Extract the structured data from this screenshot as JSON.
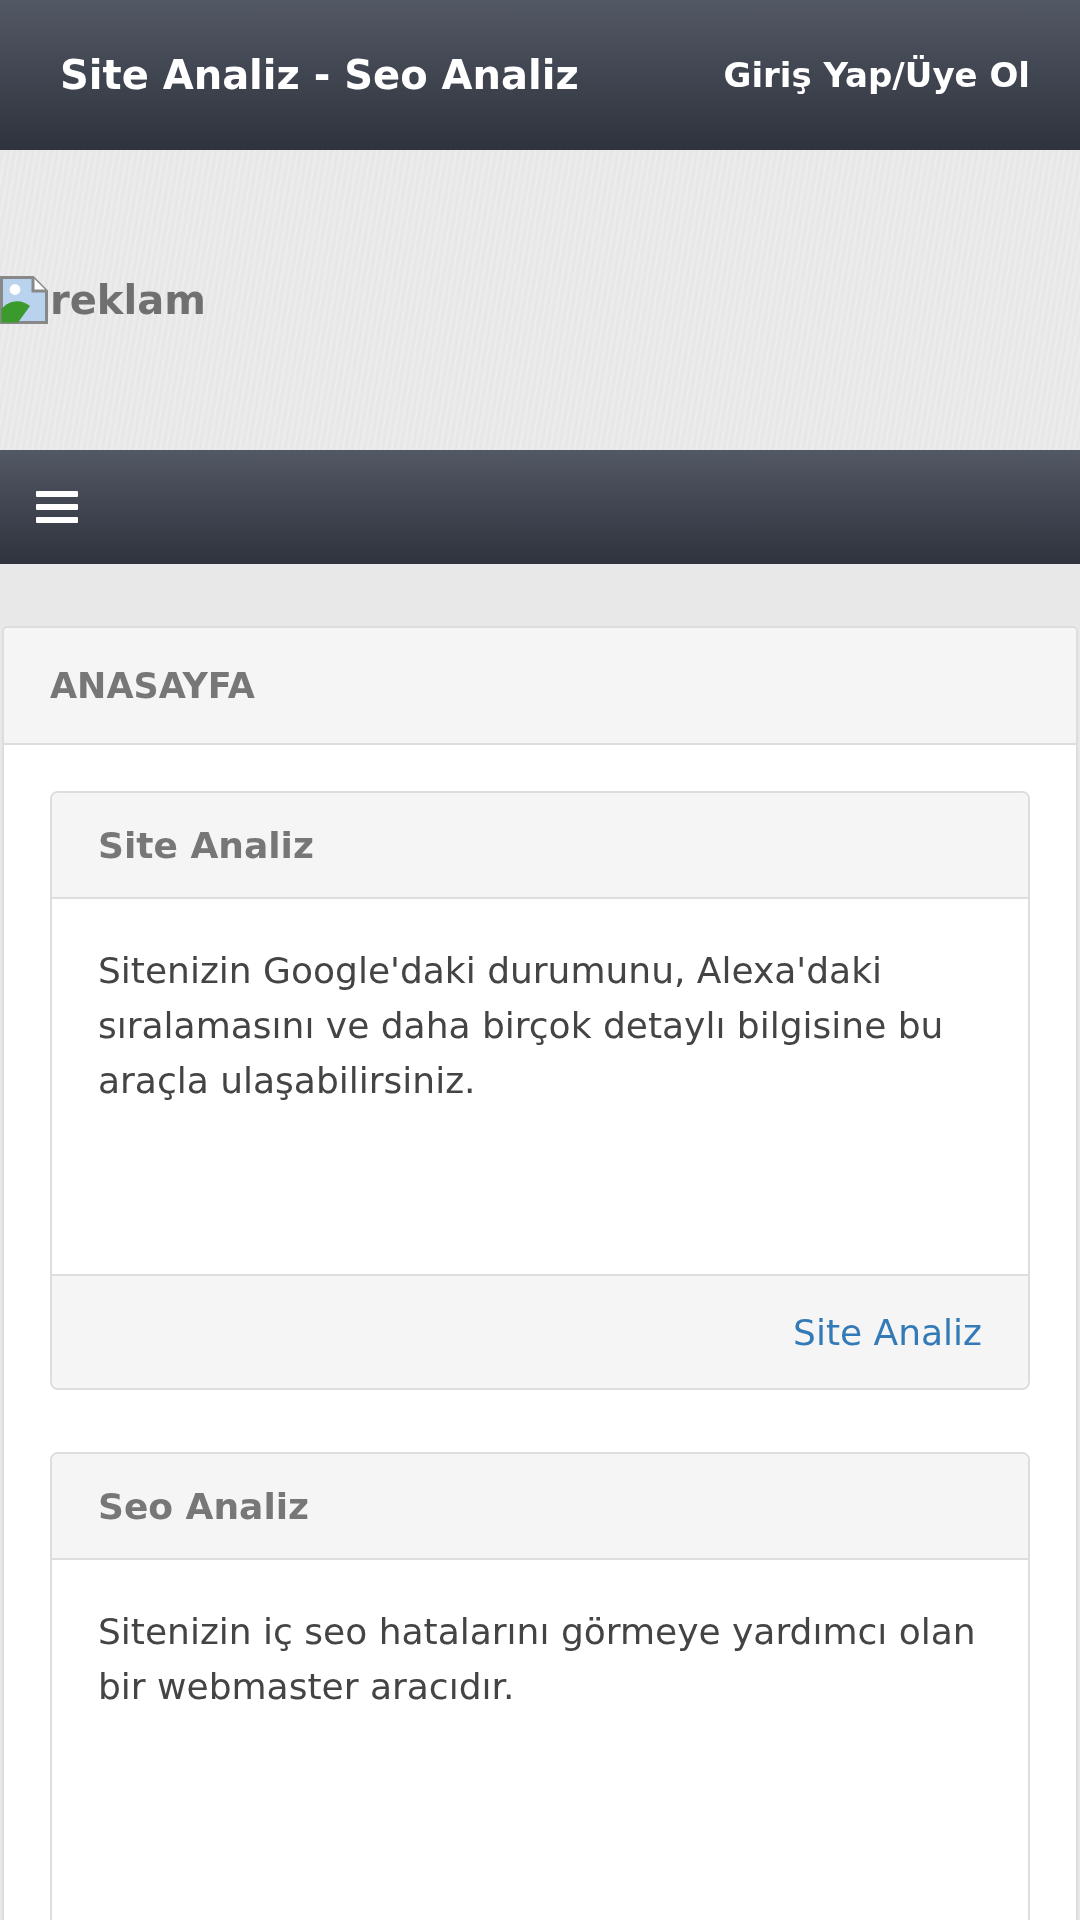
{
  "header": {
    "title": "Site Analiz - Seo Analiz",
    "login_link": "Giriş Yap/Üye Ol"
  },
  "banner": {
    "image_alt": "reklam"
  },
  "panel": {
    "title": "ANASAYFA",
    "cards": [
      {
        "title": "Site Analiz",
        "body": "Sitenizin Google'daki durumunu, Alexa'daki sıralamasını ve daha birçok detaylı bilgisine bu araçla ulaşabilirsiniz.",
        "footer_link": "Site Analiz"
      },
      {
        "title": "Seo Analiz",
        "body": "Sitenizin iç seo hatalarını görmeye yardımcı olan bir webmaster aracıdır."
      }
    ]
  }
}
